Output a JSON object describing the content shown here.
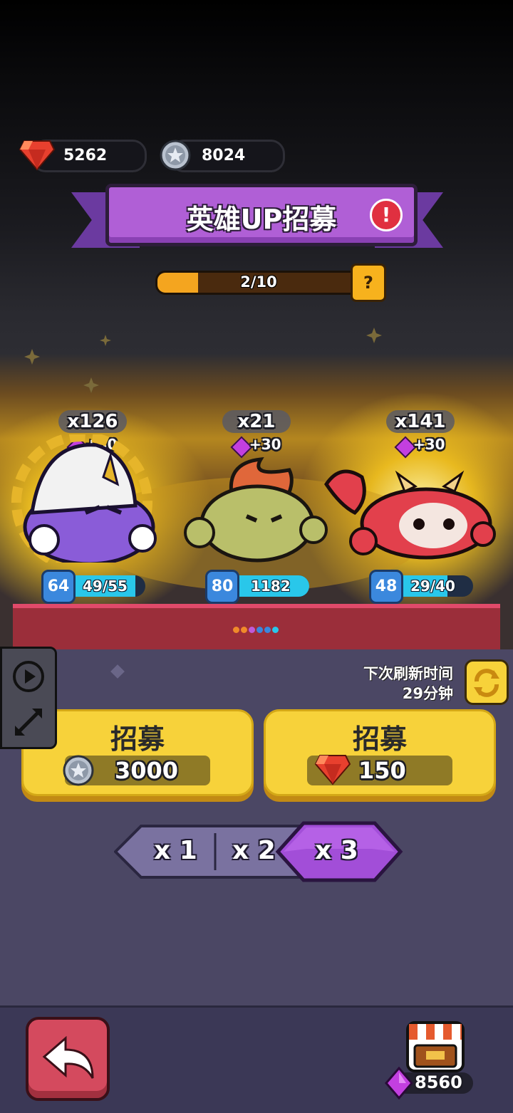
{
  "currencies": {
    "rubies": "5262",
    "coins": "8024"
  },
  "banner": {
    "title": "英雄UP招募",
    "alert": "!"
  },
  "progress": {
    "label": "2/10",
    "value": 0.2,
    "help": "?"
  },
  "heroes": [
    {
      "count": "x126",
      "bonus": "+30",
      "level": "64",
      "progress_text": "49/55",
      "progress": 0.89,
      "color": "#8a5cd8"
    },
    {
      "count": "x21",
      "bonus": "+30",
      "level": "80",
      "progress_text": "1182",
      "progress": 1.0,
      "color": "#b9bf6a"
    },
    {
      "count": "x141",
      "bonus": "+30",
      "level": "48",
      "progress_text": "29/40",
      "progress": 0.72,
      "color": "#e2404c"
    }
  ],
  "refresh": {
    "line1": "下次刷新时间",
    "line2": "29分钟"
  },
  "recruit": [
    {
      "title": "招募",
      "cost": "3000",
      "currency_icon": "silver-coin-icon"
    },
    {
      "title": "招募",
      "cost": "150",
      "currency_icon": "ruby-icon"
    }
  ],
  "multipliers": [
    {
      "label": "x 1",
      "selected": false
    },
    {
      "label": "x 2",
      "selected": false
    },
    {
      "label": "x 3",
      "selected": true
    }
  ],
  "shop": {
    "gems": "8560"
  },
  "colors": {
    "accent_purple": "#b05fd6",
    "button_yellow": "#f7d23a",
    "panel": "#4b4764"
  }
}
